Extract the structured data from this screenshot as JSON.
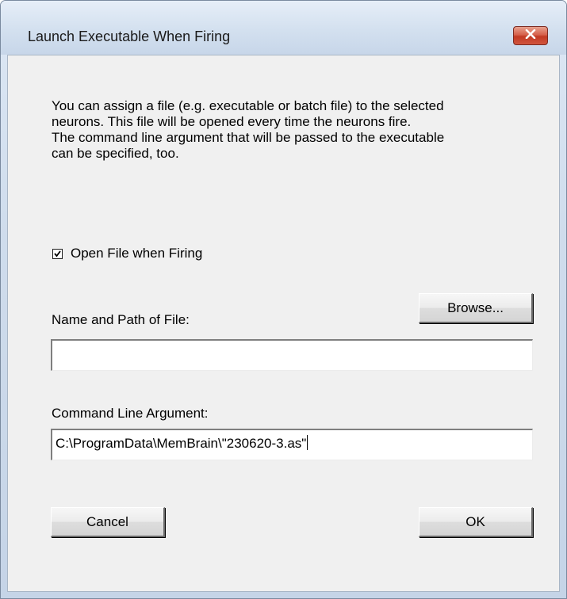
{
  "window": {
    "title": "Launch Executable When Firing",
    "close_icon": "close-x-icon"
  },
  "description": {
    "lines": [
      "You can assign a file (e.g. executable or batch file) to the selected",
      "neurons. This file will be opened every time the neurons fire.",
      "The command line argument that will be passed to the executable",
      "can be specified, too."
    ]
  },
  "open_file_checkbox": {
    "label": "Open File when Firing",
    "checked": true
  },
  "file_path": {
    "label": "Name and Path of File:",
    "value": "",
    "browse_label": "Browse..."
  },
  "command_line": {
    "label": "Command Line Argument:",
    "value": "C:\\ProgramData\\MemBrain\\\"230620-3.as\""
  },
  "buttons": {
    "cancel_label": "Cancel",
    "ok_label": "OK"
  },
  "colors": {
    "close_button": "#c8452d",
    "dialog_background": "#f0f0f0",
    "frame": "#cfdcec"
  }
}
